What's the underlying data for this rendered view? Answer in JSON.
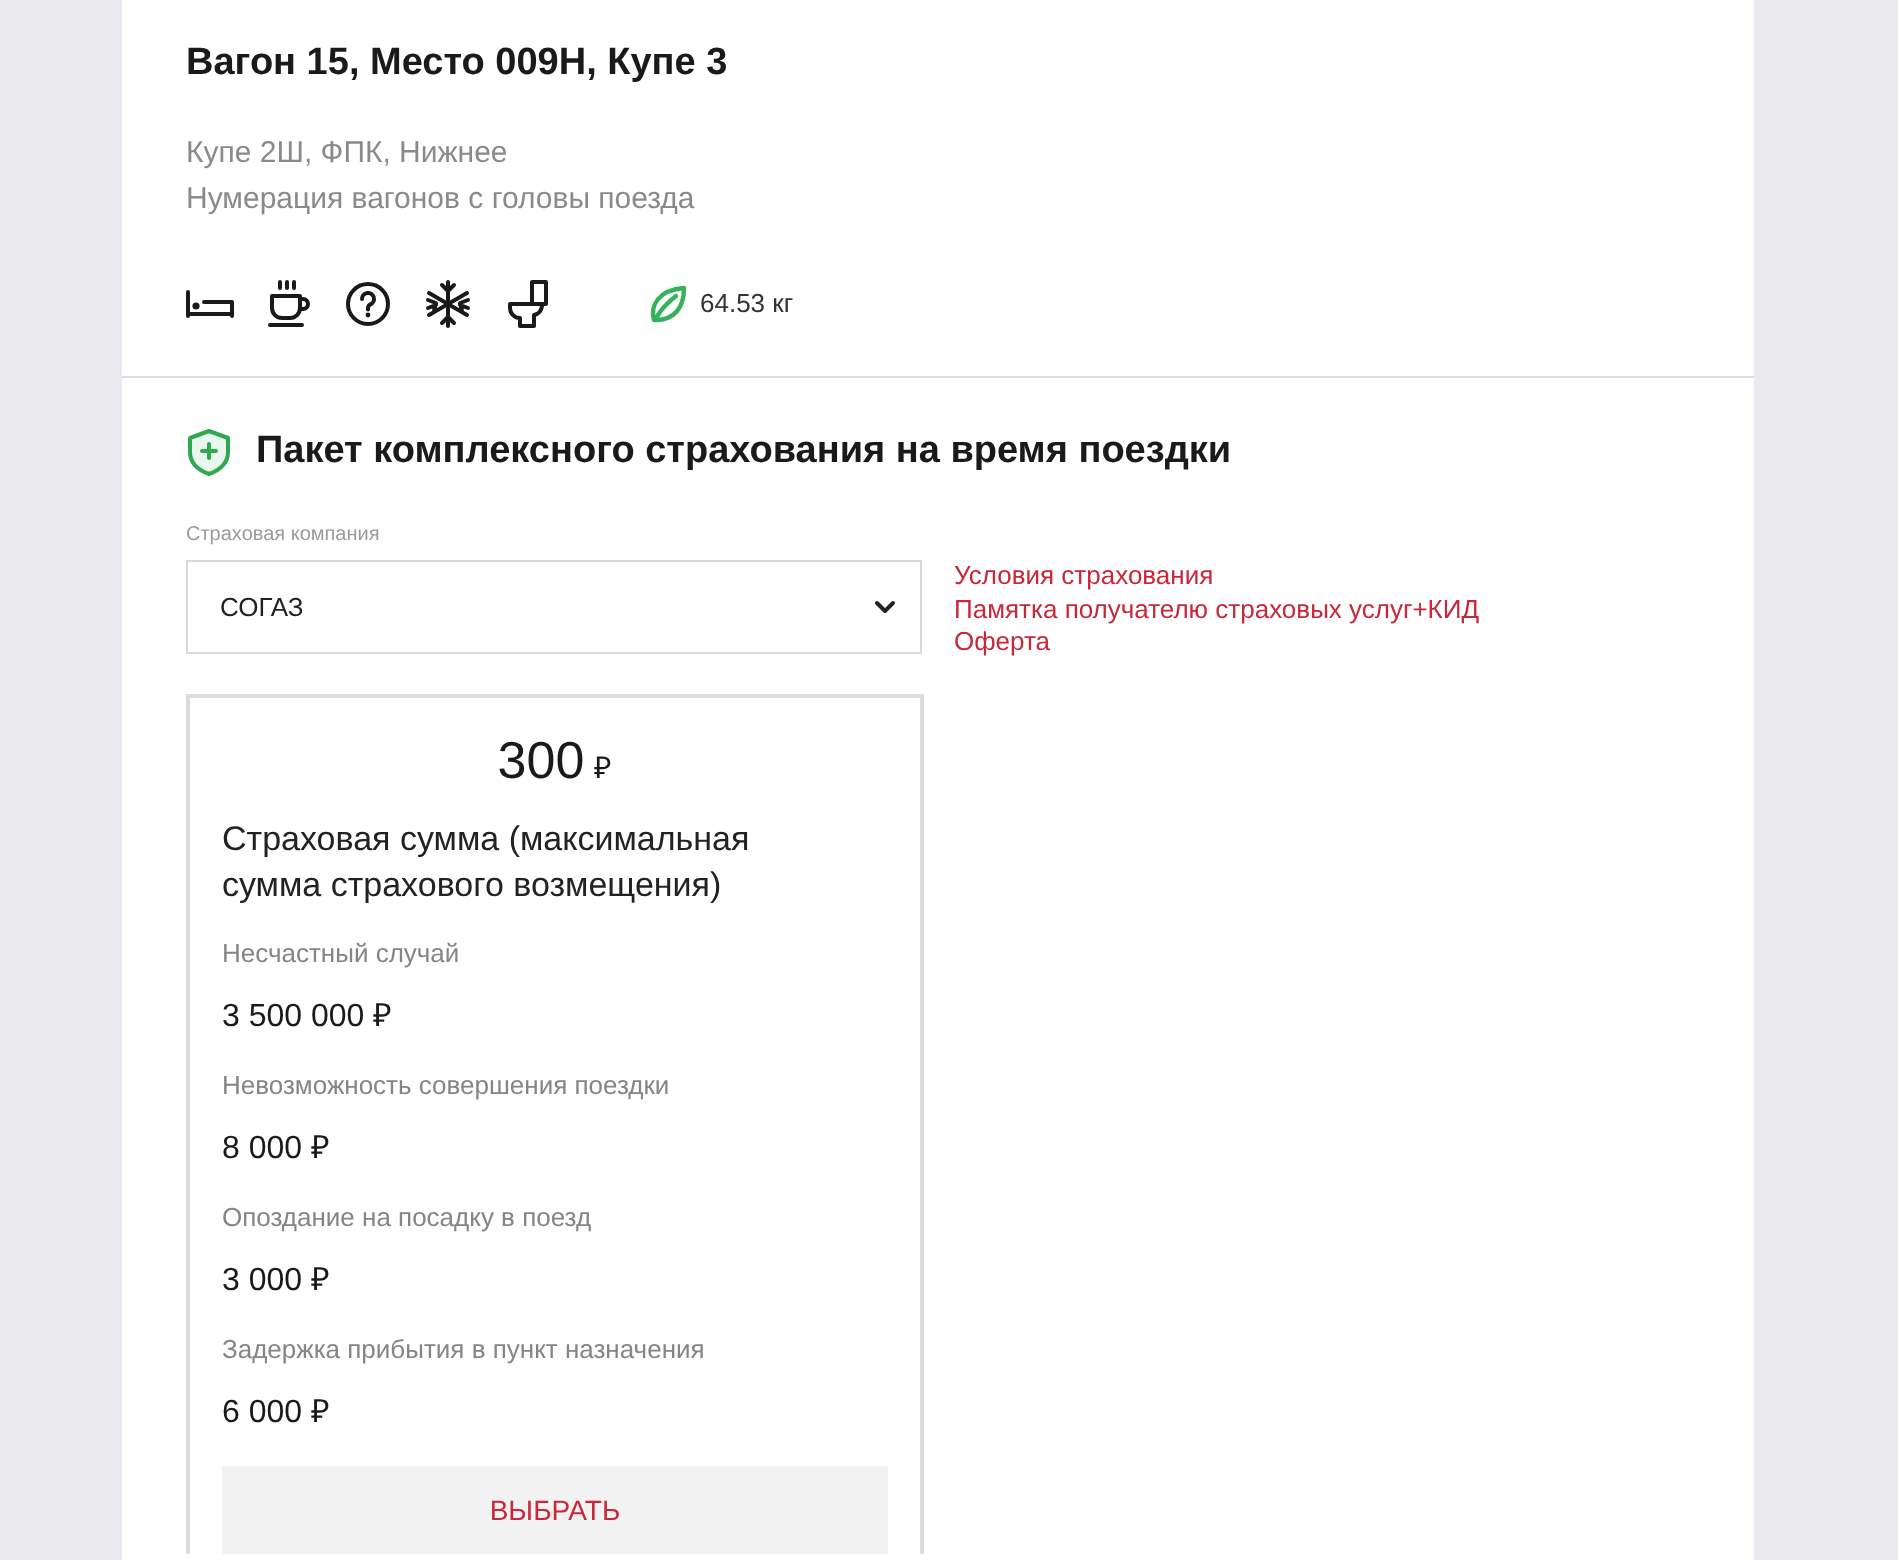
{
  "seat": {
    "title": "Вагон 15, Место 009Н, Купе 3",
    "details": [
      "Купе 2Ш, ФПК, Нижнее",
      "Нумерация вагонов с головы поезда"
    ],
    "amenities": [
      {
        "kind": "bed"
      },
      {
        "kind": "coffee"
      },
      {
        "kind": "help"
      },
      {
        "kind": "snowflake"
      },
      {
        "kind": "toilet"
      }
    ],
    "carbon": "64.53 кг"
  },
  "insurance": {
    "title": "Пакет комплексного страхования на время поездки",
    "company_field": {
      "label": "Страховая компания",
      "value": "СОГАЗ"
    },
    "links": [
      "Условия страхования",
      "Памятка получателю страховых услуг+КИД",
      "Оферта"
    ],
    "offer": {
      "price": "300",
      "currency": "₽",
      "heading": "Страховая сумма (максимальная сумма страхового возмещения)",
      "coverage": [
        {
          "label": "Несчастный случай",
          "amount": "3 500 000 ₽"
        },
        {
          "label": "Невозможность совершения поездки",
          "amount": "8 000 ₽"
        },
        {
          "label": "Опоздание на посадку в поезд",
          "amount": "3 000 ₽"
        },
        {
          "label": "Задержка прибытия в пункт назначения",
          "amount": "6 000 ₽"
        }
      ],
      "button": "ВЫБРАТЬ"
    }
  }
}
